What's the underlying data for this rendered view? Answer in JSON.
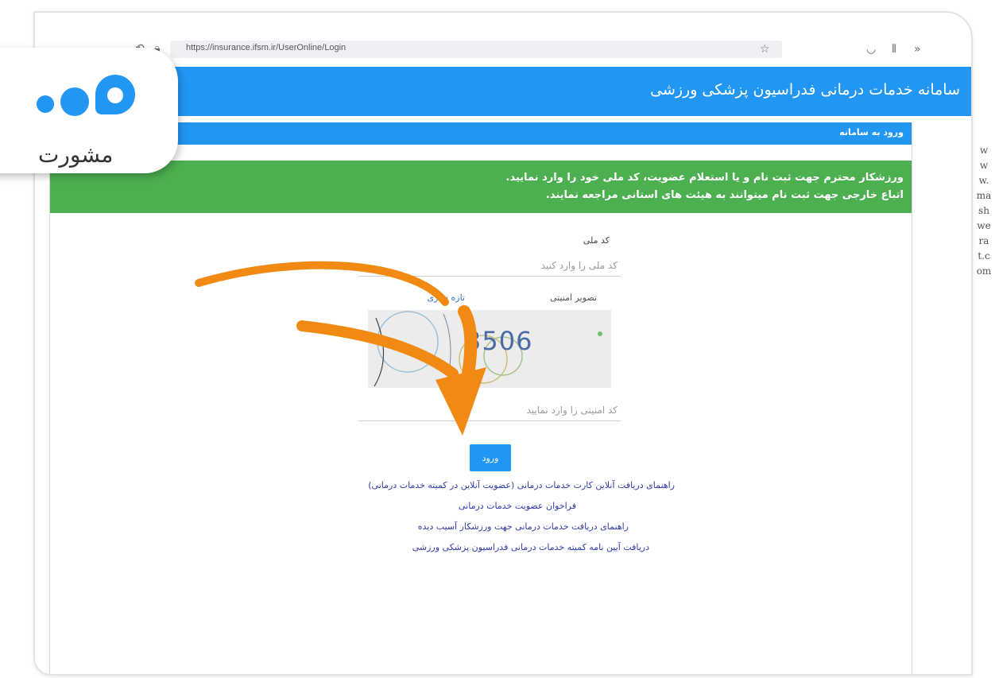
{
  "browser": {
    "url": "https://insurance.ifsm.ir/UserOnline/Login",
    "icons": [
      "back-arrow-icon",
      "lock-icon",
      "star-bookmark-icon",
      "pocket-icon",
      "library-icon",
      "overflow-chevron-icon"
    ]
  },
  "site": {
    "title": "سامانه خدمات درمانی فدراسیون پزشکی ورزشی"
  },
  "panel": {
    "heading": "ورود به سامانه",
    "alert_line1": "ورزشکار محترم جهت ثبت نام و یا استعلام عضویت، کد ملی خود را وارد نمایید.",
    "alert_line2": "اتباع خارجی جهت ثبت نام میتوانند به هیئت های استانی مراجعه نمایند."
  },
  "form": {
    "national_code_label": "کد ملی",
    "national_code_placeholder": "کد ملی را وارد کنید",
    "captcha_label": "تصویر امنیتی",
    "refresh_label": "تازه سازی",
    "captcha_text": "3506",
    "security_placeholder": "کد امنیتی را وارد نمایید",
    "login_button": "ورود"
  },
  "links": [
    "راهنمای دریافت آنلاین کارت خدمات درمانی (عضویت آنلاین در کمیته خدمات درمانی)",
    "فراخوان عضویت خدمات درمانی",
    "راهنمای دریافت خدمات درمانی جهت ورزشکار آسیب دیده",
    "دریافت آیین نامه کمیته خدمات درمانی فدراسیون پزشکی ورزشی"
  ],
  "overlay": {
    "logo_text": "مشورت",
    "watermark": "www.mashwerat.com"
  },
  "colors": {
    "header_blue": "#2196f3",
    "alert_green": "#4caf50",
    "link_blue": "#2f3aa8",
    "arrow_orange": "#f08a12"
  }
}
